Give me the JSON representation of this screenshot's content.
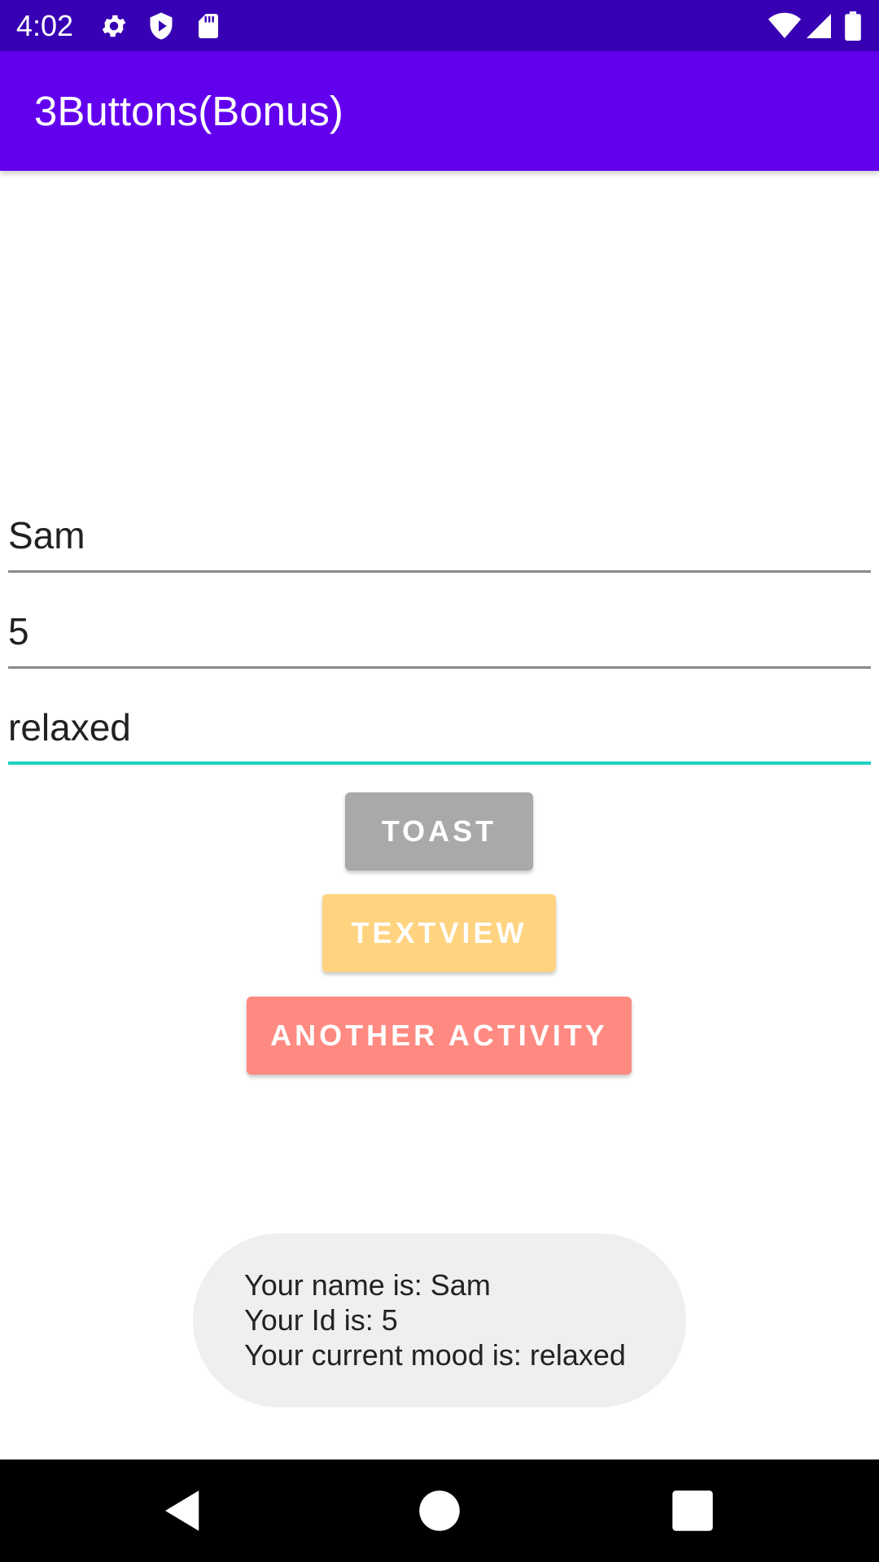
{
  "status_bar": {
    "time": "4:02",
    "color": "#3700b3",
    "left_icons": [
      "gear-icon",
      "shield-play-icon",
      "sd-card-icon"
    ],
    "right_icons": [
      "wifi-icon",
      "cell-signal-icon",
      "battery-icon"
    ]
  },
  "app_bar": {
    "title": "3Buttons(Bonus)",
    "color": "#6200ee"
  },
  "form": {
    "name_value": "Sam",
    "id_value": "5",
    "mood_value": "relaxed",
    "focused_field": "mood",
    "focus_color": "#1ed3c1"
  },
  "buttons": {
    "toast_label": "TOAST",
    "toast_color": "#a9a9a9",
    "textview_label": "TEXTVIEW",
    "textview_color": "#ffd380",
    "another_activity_label": "ANOTHER ACTIVITY",
    "another_activity_color": "#fe8a81"
  },
  "toast": {
    "line1": "Your name is: Sam",
    "line2": "Your Id is: 5",
    "line3": "Your current mood is: relaxed"
  },
  "nav_bar": {
    "icons": [
      "back-icon",
      "home-icon",
      "recents-icon"
    ]
  }
}
